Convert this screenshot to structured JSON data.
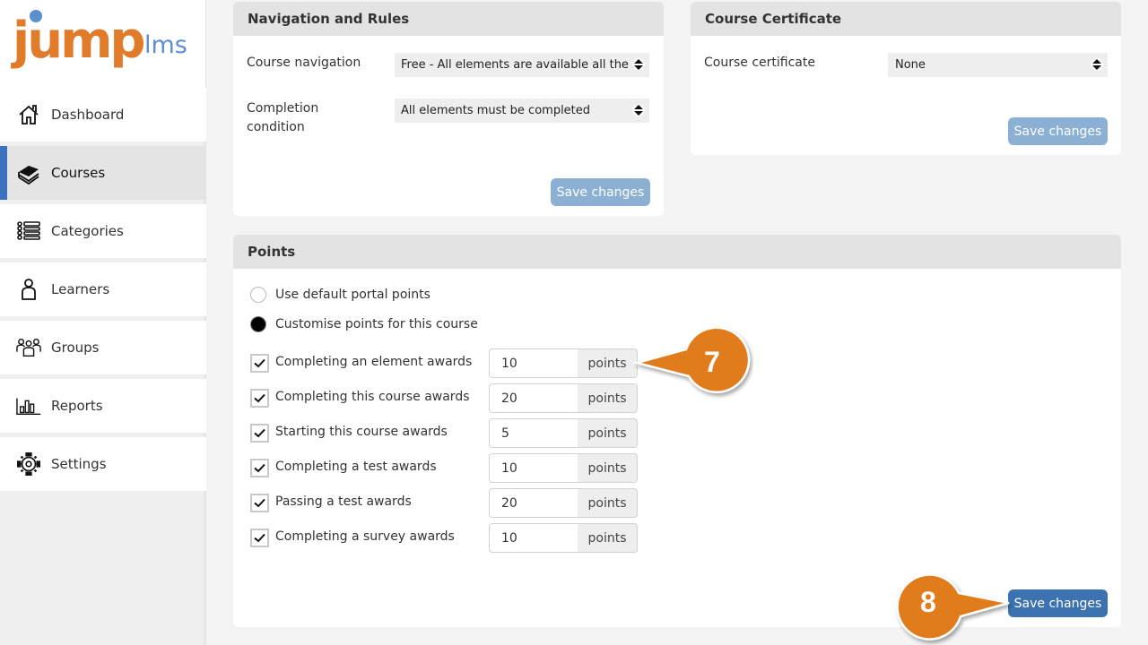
{
  "brand": {
    "name_main": "jump",
    "name_suffix": "lms",
    "primary_color": "#e07b2a",
    "accent_color": "#5b8fcf"
  },
  "sidebar": {
    "items": [
      {
        "label": "Dashboard",
        "icon": "home-icon",
        "active": false
      },
      {
        "label": "Courses",
        "icon": "books-icon",
        "active": true
      },
      {
        "label": "Categories",
        "icon": "list-icon",
        "active": false
      },
      {
        "label": "Learners",
        "icon": "user-icon",
        "active": false
      },
      {
        "label": "Groups",
        "icon": "group-icon",
        "active": false
      },
      {
        "label": "Reports",
        "icon": "bar-chart-icon",
        "active": false
      },
      {
        "label": "Settings",
        "icon": "gear-icon",
        "active": false
      }
    ]
  },
  "navigation_rules": {
    "title": "Navigation and Rules",
    "course_navigation_label": "Course navigation",
    "course_navigation_value": "Free - All elements are available all the ...",
    "completion_condition_label": "Completion condition",
    "completion_condition_value": "All elements must be completed",
    "save_label": "Save changes"
  },
  "certificate": {
    "title": "Course Certificate",
    "label": "Course certificate",
    "value": "None",
    "save_label": "Save changes"
  },
  "points": {
    "title": "Points",
    "radio_options": [
      {
        "label": "Use default portal points",
        "checked": false
      },
      {
        "label": "Customise points for this course",
        "checked": true
      }
    ],
    "unit_label": "points",
    "rows": [
      {
        "label": "Completing an element awards",
        "value": "10",
        "checked": true
      },
      {
        "label": "Completing this course awards",
        "value": "20",
        "checked": true
      },
      {
        "label": "Starting this course awards",
        "value": "5",
        "checked": true
      },
      {
        "label": "Completing a test awards",
        "value": "10",
        "checked": true
      },
      {
        "label": "Passing a test awards",
        "value": "20",
        "checked": true
      },
      {
        "label": "Completing a survey awards",
        "value": "10",
        "checked": true
      }
    ],
    "save_label": "Save changes"
  },
  "callouts": [
    {
      "number": "7",
      "color": "#e07b1a"
    },
    {
      "number": "8",
      "color": "#e07b1a"
    }
  ]
}
